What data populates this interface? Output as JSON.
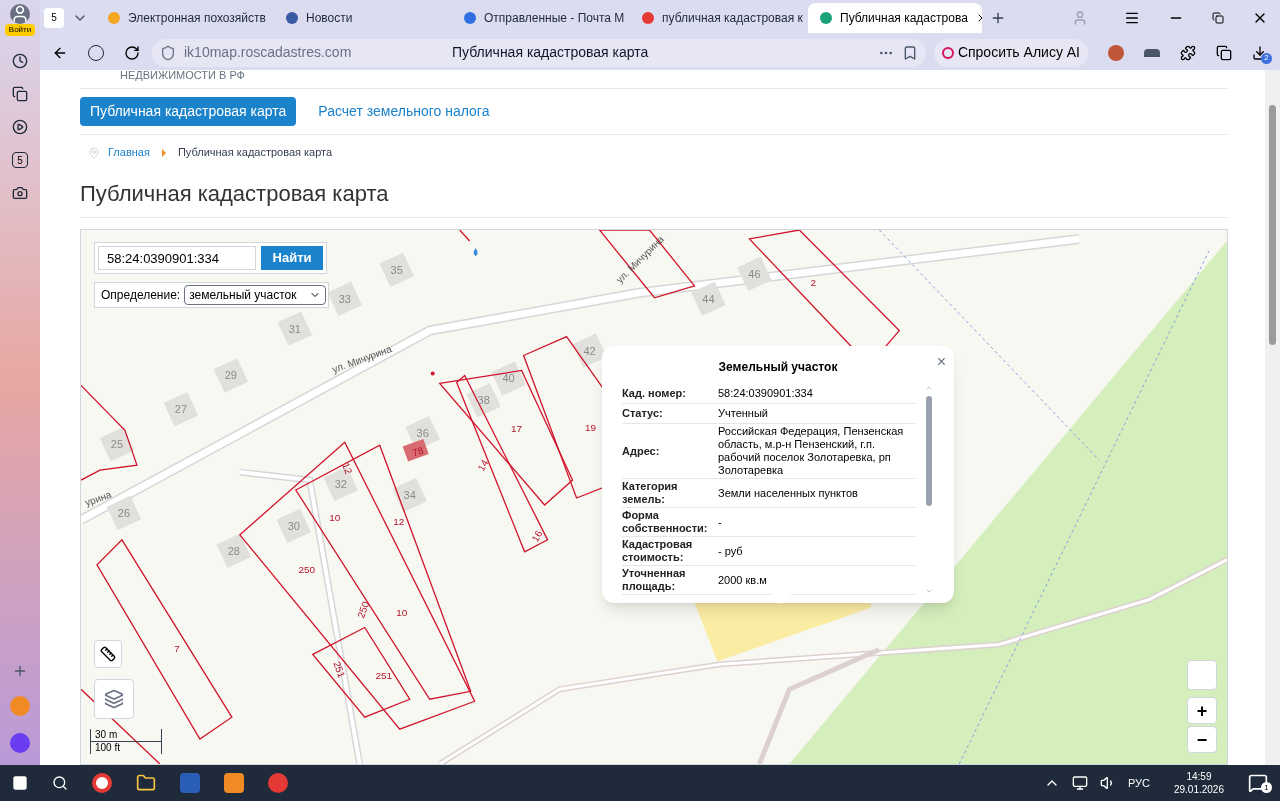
{
  "browser": {
    "profile_label": "Войти",
    "sidebar_badge": "5",
    "tab_group_count": "5",
    "tabs": [
      {
        "title": "Электронная похозяйств",
        "selected": false
      },
      {
        "title": "Новости",
        "selected": false
      },
      {
        "title": "Отправленные - Почта М",
        "selected": false
      },
      {
        "title": "публичная кадастровая к",
        "selected": false
      },
      {
        "title": "Публичная кадастрова",
        "selected": true
      }
    ],
    "url": "ik10map.roscadastres.com",
    "page_title": "Публичная кадастровая карта",
    "alice_button": "Спросить Алису AI",
    "downloads_badge": "2"
  },
  "page": {
    "site_name": "НЕДВИЖИМОСТИ В РФ",
    "nav": [
      {
        "label": "Публичная кадастровая карта",
        "selected": true
      },
      {
        "label": "Расчет земельного налога",
        "selected": false
      }
    ],
    "breadcrumbs": [
      {
        "label": "Главная",
        "kind": "link"
      },
      {
        "label": "Публичная кадастровая карта",
        "kind": "current"
      }
    ],
    "title": "Публичная кадастровая карта"
  },
  "map": {
    "search": {
      "value": "58:24:0390901:334",
      "button": "Найти"
    },
    "definition": {
      "label": "Определение:",
      "value": "земельный участок"
    },
    "labels": [
      {
        "text": "35",
        "kind": "house"
      },
      {
        "text": "33",
        "kind": "house"
      },
      {
        "text": "31",
        "kind": "house"
      },
      {
        "text": "29",
        "kind": "house"
      },
      {
        "text": "27",
        "kind": "house"
      },
      {
        "text": "25",
        "kind": "house"
      },
      {
        "text": "26",
        "kind": "house"
      },
      {
        "text": "28",
        "kind": "house"
      },
      {
        "text": "30",
        "kind": "house"
      },
      {
        "text": "32",
        "kind": "house"
      },
      {
        "text": "34",
        "kind": "house"
      },
      {
        "text": "36",
        "kind": "house"
      },
      {
        "text": "38",
        "kind": "house"
      },
      {
        "text": "40",
        "kind": "house"
      },
      {
        "text": "42",
        "kind": "house"
      },
      {
        "text": "44",
        "kind": "house"
      },
      {
        "text": "46",
        "kind": "house"
      },
      {
        "text": "2",
        "kind": "parcel"
      },
      {
        "text": "17",
        "kind": "parcel"
      },
      {
        "text": "19",
        "kind": "parcel"
      },
      {
        "text": "14",
        "kind": "parcel"
      },
      {
        "text": "16",
        "kind": "parcel"
      },
      {
        "text": "12",
        "kind": "parcel"
      },
      {
        "text": "78",
        "kind": "parcel"
      },
      {
        "text": "10",
        "kind": "parcel"
      },
      {
        "text": "12",
        "kind": "parcel"
      },
      {
        "text": "250",
        "kind": "parcel"
      },
      {
        "text": "250",
        "kind": "parcel"
      },
      {
        "text": "10",
        "kind": "parcel"
      },
      {
        "text": "251",
        "kind": "parcel"
      },
      {
        "text": "251",
        "kind": "parcel"
      },
      {
        "text": "7",
        "kind": "parcel"
      },
      {
        "text": "ул. Мичурина",
        "kind": "street"
      },
      {
        "text": "ул. Мичурина",
        "kind": "street"
      },
      {
        "text": "урина",
        "kind": "street"
      }
    ],
    "scale": [
      "30 m",
      "100 ft"
    ],
    "zoom": [
      "+",
      "−"
    ],
    "popup": {
      "title": "Земельный участок",
      "close": "×",
      "rows": [
        {
          "label": "Кад. номер:",
          "value": "58:24:0390901:334"
        },
        {
          "label": "Статус:",
          "value": "Учтенный"
        },
        {
          "label": "Адрес:",
          "value": "Российская Федерация, Пензенская область, м.р-н Пензенский, г.п. рабочий поселок Золотаревка, рп Золотаревка"
        },
        {
          "label": "Категория земель:",
          "value": "Земли населенных пунктов"
        },
        {
          "label": "Форма собственности:",
          "value": "-"
        },
        {
          "label": "Кадастровая стоимость:",
          "value": "- руб"
        },
        {
          "label": "Уточненная площадь:",
          "value": "2000 кв.м"
        }
      ]
    }
  },
  "taskbar": {
    "language": "РУС",
    "time": "14:59",
    "date": "29.01.2026",
    "notifications": "1"
  }
}
